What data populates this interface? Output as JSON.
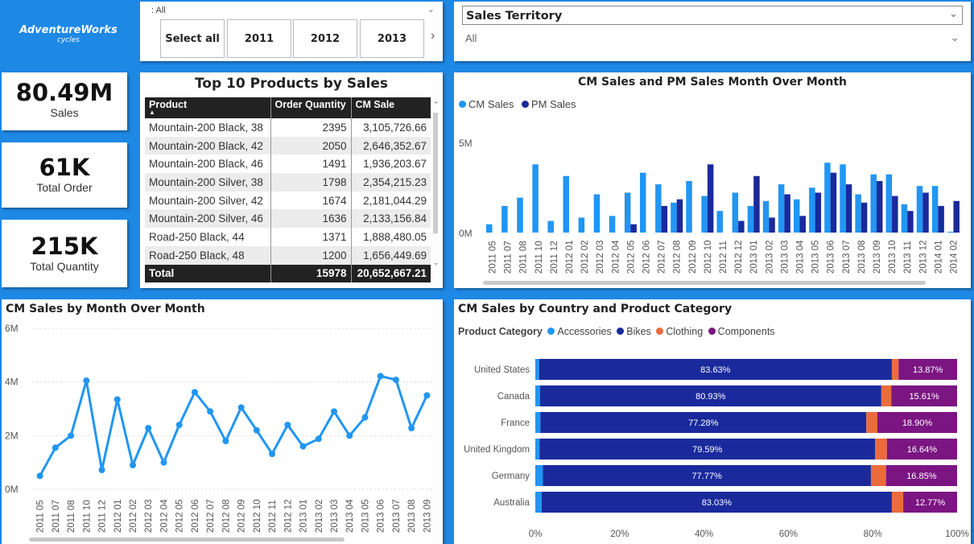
{
  "logo": {
    "name": "AdventureWorks",
    "sub": "cycles"
  },
  "year_slicer": {
    "value": ": All",
    "buttons": [
      "Select all",
      "2011",
      "2012",
      "2013"
    ]
  },
  "territory_slicer": {
    "title": "Sales Territory",
    "value": "All"
  },
  "kpis": [
    {
      "value": "80.49M",
      "label": "Sales"
    },
    {
      "value": "61K",
      "label": "Total Order"
    },
    {
      "value": "215K",
      "label": "Total Quantity"
    }
  ],
  "top_products": {
    "title": "Top 10 Products by Sales",
    "columns": [
      "Product",
      "Order Quantity",
      "CM Sale"
    ],
    "rows": [
      [
        "Mountain-200 Black, 38",
        "2395",
        "3,105,726.66"
      ],
      [
        "Mountain-200 Black, 42",
        "2050",
        "2,646,352.67"
      ],
      [
        "Mountain-200 Black, 46",
        "1491",
        "1,936,203.67"
      ],
      [
        "Mountain-200 Silver, 38",
        "1798",
        "2,354,215.23"
      ],
      [
        "Mountain-200 Silver, 42",
        "1674",
        "2,181,044.29"
      ],
      [
        "Mountain-200 Silver, 46",
        "1636",
        "2,133,156.84"
      ],
      [
        "Road-250 Black, 44",
        "1371",
        "1,888,480.05"
      ],
      [
        "Road-250 Black, 48",
        "1200",
        "1,656,449.69"
      ]
    ],
    "total": [
      "Total",
      "15978",
      "20,652,667.21"
    ]
  },
  "chart_data": [
    {
      "type": "bar",
      "title": "CM Sales and PM Sales Month Over Month",
      "categories": [
        "2011 05",
        "2011 07",
        "2011 08",
        "2011 10",
        "2011 12",
        "2012 01",
        "2012 02",
        "2012 03",
        "2012 04",
        "2012 05",
        "2012 06",
        "2012 07",
        "2012 08",
        "2012 09",
        "2012 10",
        "2012 11",
        "2012 12",
        "2013 01",
        "2013 02",
        "2013 03",
        "2013 04",
        "2013 05",
        "2013 06",
        "2013 07",
        "2013 08",
        "2013 09",
        "2013 10",
        "2013 11",
        "2013 12",
        "2014 01",
        "2014 02"
      ],
      "series": [
        {
          "name": "CM Sales",
          "color": "#2196f3",
          "values": [
            0.5,
            1.6,
            2.1,
            4.1,
            0.7,
            3.4,
            0.9,
            2.3,
            1.0,
            2.4,
            3.6,
            2.9,
            1.8,
            3.1,
            2.2,
            1.3,
            2.4,
            1.6,
            1.9,
            2.9,
            2.0,
            2.7,
            4.2,
            4.1,
            2.3,
            3.5,
            3.5,
            1.7,
            2.8,
            2.8,
            0.05
          ]
        },
        {
          "name": "PM Sales",
          "color": "#1a2a9c",
          "values": [
            0,
            0,
            0,
            0,
            0,
            0,
            0,
            0,
            0,
            0.5,
            0,
            1.6,
            2.0,
            0,
            4.1,
            0,
            0.7,
            3.4,
            0.9,
            2.3,
            1.0,
            2.4,
            3.6,
            2.9,
            1.8,
            3.1,
            2.2,
            1.3,
            2.4,
            1.6,
            1.9
          ]
        }
      ],
      "yticks": [
        "5M",
        "0M"
      ],
      "ylim": [
        0,
        6
      ]
    },
    {
      "type": "line",
      "title": "CM Sales by Month Over Month",
      "categories": [
        "2011 05",
        "2011 07",
        "2011 08",
        "2011 10",
        "2011 12",
        "2012 01",
        "2012 02",
        "2012 03",
        "2012 04",
        "2012 05",
        "2012 06",
        "2012 07",
        "2012 08",
        "2012 09",
        "2012 10",
        "2012 11",
        "2012 12",
        "2013 01",
        "2013 02",
        "2013 03",
        "2013 04",
        "2013 05",
        "2013 06",
        "2013 07",
        "2013 08",
        "2013 09"
      ],
      "series": [
        {
          "name": "CM Sales",
          "color": "#2196f3",
          "values": [
            0.5,
            1.55,
            2.0,
            4.05,
            0.72,
            3.35,
            0.9,
            2.28,
            1.0,
            2.4,
            3.62,
            2.9,
            1.8,
            3.05,
            2.2,
            1.32,
            2.4,
            1.6,
            1.88,
            2.9,
            2.0,
            2.68,
            4.22,
            4.08,
            2.28,
            3.5
          ]
        }
      ],
      "yticks": [
        "6M",
        "4M",
        "2M",
        "0M"
      ],
      "ylim": [
        0,
        6
      ]
    },
    {
      "type": "bar",
      "title": "CM Sales by Country and Product Category",
      "legend_title": "Product Category",
      "categories": [
        "United States",
        "Canada",
        "France",
        "United Kingdom",
        "Germany",
        "Australia"
      ],
      "series": [
        {
          "name": "Accessories",
          "color": "#2196f3",
          "values": [
            0.9,
            1.1,
            1.2,
            1.0,
            1.8,
            1.5
          ]
        },
        {
          "name": "Bikes",
          "color": "#1a2a9c",
          "values": [
            83.63,
            80.93,
            77.28,
            79.59,
            77.77,
            83.03
          ]
        },
        {
          "name": "Clothing",
          "color": "#ec6b3c",
          "values": [
            1.6,
            2.36,
            2.62,
            2.77,
            3.58,
            2.7
          ]
        },
        {
          "name": "Components",
          "color": "#7b1582",
          "values": [
            13.87,
            15.61,
            18.9,
            16.64,
            16.85,
            12.77
          ]
        }
      ],
      "data_labels": {
        "Bikes": [
          "83.63%",
          "80.93%",
          "77.28%",
          "79.59%",
          "77.77%",
          "83.03%"
        ],
        "Components": [
          "13.87%",
          "15.61%",
          "18.90%",
          "16.64%",
          "16.85%",
          "12.77%"
        ]
      },
      "xticks": [
        "0%",
        "20%",
        "40%",
        "60%",
        "80%",
        "100%"
      ],
      "xlim": [
        0,
        100
      ]
    }
  ]
}
